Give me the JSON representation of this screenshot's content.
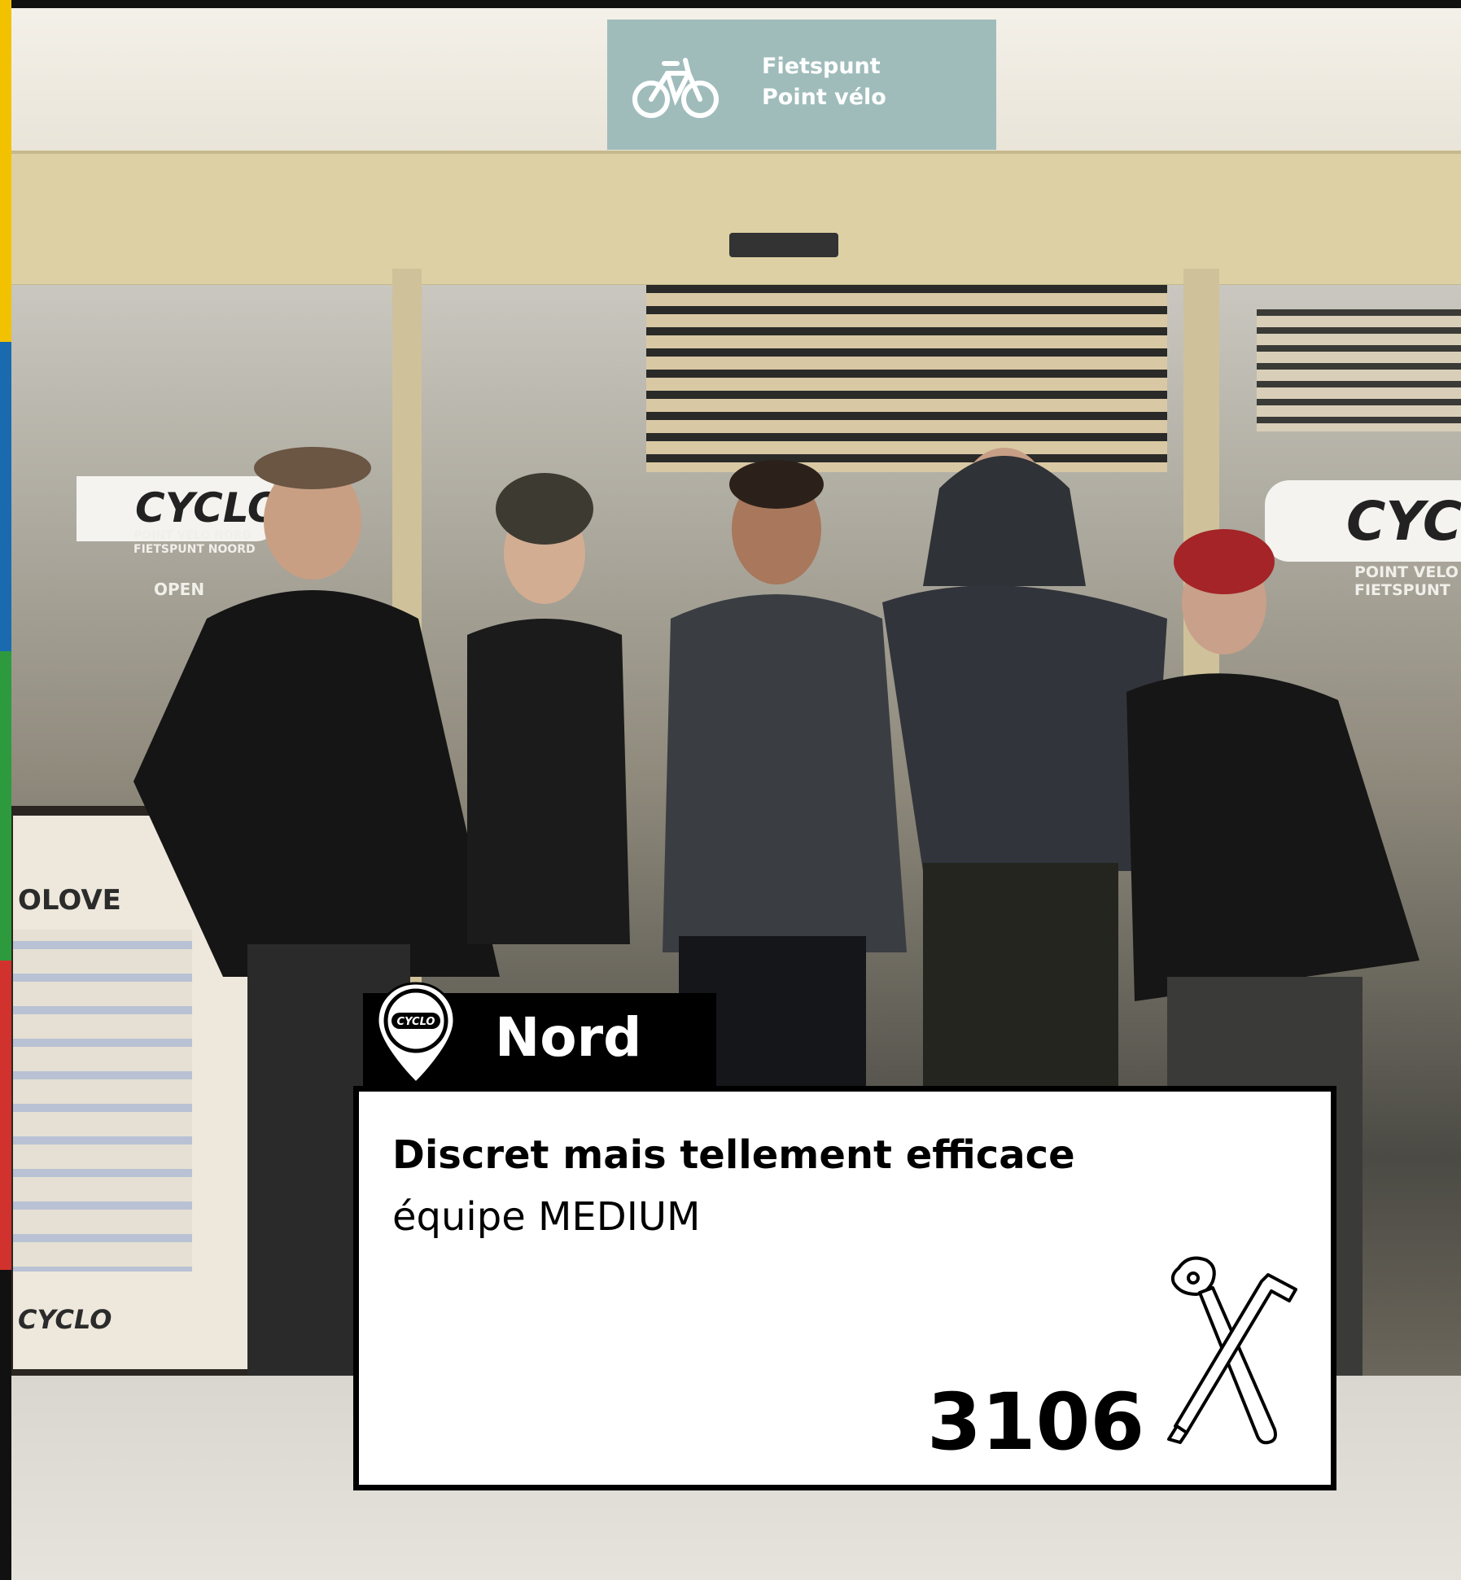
{
  "location": {
    "name": "Nord",
    "pin_logo_text": "CYCLO"
  },
  "team": {
    "tagline": "Discret mais tellement efficace",
    "name": "équipe MEDIUM",
    "score": "3106",
    "score_icon": "bike-tools-icon"
  },
  "photo": {
    "scene": "bike-repair-shop-team",
    "people_count": 5,
    "signage": {
      "hanging_sign_line1": "Fietspunt",
      "hanging_sign_line2": "Point vélo",
      "window_brand": "CYCLO",
      "window_subtitle": "POINT VELO NORD FIETSPUNT NOORD",
      "right_window_subtitle": "POINT VELO FIETSPUNT",
      "hours_heading": "OPEN",
      "board_title": "OLOVE",
      "board_brand": "CYCLO"
    }
  },
  "colors": {
    "card_background": "#ffffff",
    "card_border": "#000000",
    "tab_background": "#000000",
    "left_stripe": [
      "#f2c200",
      "#1a6ab0",
      "#2e9a3e",
      "#d2322d"
    ]
  }
}
